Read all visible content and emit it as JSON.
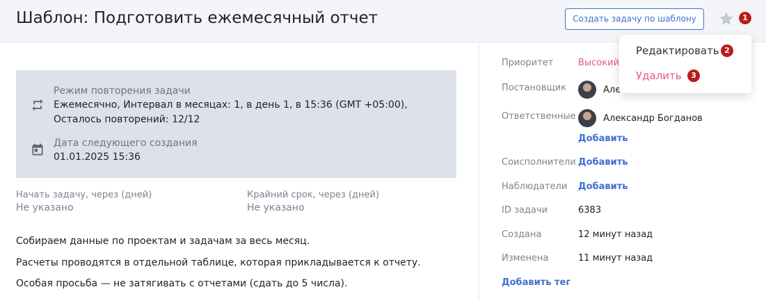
{
  "header": {
    "title": "Шаблон: Подготовить ежемесячный отчет",
    "create_button": "Создать задачу по шаблону"
  },
  "badges": [
    "1",
    "2",
    "3"
  ],
  "repeat": {
    "mode_label": "Режим повторения задачи",
    "mode_value": "Ежемесячно, Интервал в месяцах: 1, в день 1, в 15:36 (GMT +05:00), Осталось повторений: 12/12",
    "next_label": "Дата следующего создания",
    "next_value": "01.01.2025 15:36"
  },
  "fields": {
    "start_label": "Начать задачу, через (дней)",
    "start_value": "Не указано",
    "deadline_label": "Крайний срок, через (дней)",
    "deadline_value": "Не указано"
  },
  "description": [
    "Собираем данные по проектам и задачам за весь месяц.",
    "Расчеты проводятся в отдельной таблице, которая прикладывается к отчету.",
    "Особая просьба — не затягивать с отчетами (сдать до 5 числа)."
  ],
  "sidebar": {
    "priority_label": "Приоритет",
    "priority_value": "Высокий",
    "author_label": "Постановщик",
    "author_name": "Але...",
    "assignees_label": "Ответственные",
    "assignee_name": "Александр Богданов",
    "add": "Добавить",
    "coexecutors_label": "Соисполнители",
    "observers_label": "Наблюдатели",
    "id_label": "ID задачи",
    "id_value": "6383",
    "created_label": "Создана",
    "created_value": "12 минут назад",
    "modified_label": "Изменена",
    "modified_value": "11 минут назад",
    "add_tag": "Добавить тег"
  },
  "menu": {
    "edit": "Редактировать",
    "delete": "Удалить"
  },
  "colors": {
    "accent": "#3f6fd1",
    "priority_high": "#e8577a",
    "badge": "#b71c1c",
    "repeat_box": "#dde1e9"
  }
}
